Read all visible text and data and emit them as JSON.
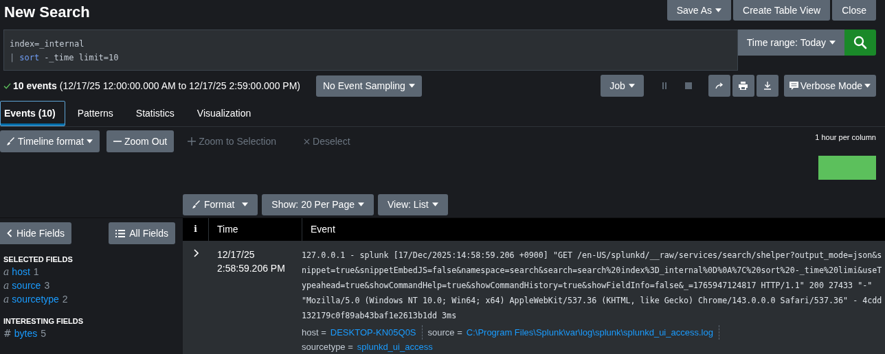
{
  "title": "New Search",
  "header_buttons": [
    {
      "label": "Save As",
      "caret": true
    },
    {
      "label": "Create Table View",
      "caret": false
    },
    {
      "label": "Close",
      "caret": false
    }
  ],
  "search": {
    "lines": [
      [
        {
          "text": "index=_internal",
          "kind": "plain"
        }
      ],
      [
        {
          "text": "|",
          "kind": "pipe"
        },
        {
          "text": "sort",
          "kind": "command"
        },
        {
          "text": "-_time limit=10",
          "kind": "plain"
        }
      ]
    ],
    "time_range": "Time range: Today"
  },
  "status": {
    "summary": "**10 events** (12/17/25 12:00:00.000 AM to 12/17/25 2:59:00.000 PM)",
    "sampling": "No Event Sampling"
  },
  "job": {
    "label": "Job",
    "pause_disabled": true,
    "stop_disabled": true,
    "mode": "Verbose Mode"
  },
  "tabs": [
    {
      "label": "Events (10)",
      "selected": true
    },
    {
      "label": "Patterns",
      "selected": false
    },
    {
      "label": "Statistics",
      "selected": false
    },
    {
      "label": "Visualization",
      "selected": false
    }
  ],
  "timeline": {
    "buttons": [
      {
        "label": "Timeline format",
        "kind": "format",
        "caret": true,
        "disabled": false
      },
      {
        "label": "Zoom Out",
        "kind": "zoomout",
        "caret": false,
        "disabled": false
      },
      {
        "label": "Zoom to Selection",
        "kind": "zoomin",
        "caret": false,
        "disabled": true
      },
      {
        "label": "Deselect",
        "kind": "deselect",
        "caret": false,
        "disabled": true
      }
    ],
    "scale": "1 hour per column"
  },
  "results_toolbar": [
    {
      "label": "Format",
      "kind": "format"
    },
    {
      "label": "Show: 20 Per Page",
      "kind": "menu"
    },
    {
      "label": "View: List",
      "kind": "menu"
    }
  ],
  "sidebar": {
    "hide_button": "Hide Fields",
    "all_button": "All Fields",
    "sections": [
      {
        "title": "SELECTED FIELDS",
        "fields": [
          {
            "type": "a",
            "name": "host",
            "count": "1"
          },
          {
            "type": "a",
            "name": "source",
            "count": "3"
          },
          {
            "type": "a",
            "name": "sourcetype",
            "count": "2"
          }
        ]
      },
      {
        "title": "INTERESTING FIELDS",
        "fields": [
          {
            "type": "#",
            "name": "bytes",
            "count": "5"
          }
        ]
      }
    ]
  },
  "table": {
    "columns": [
      "i",
      "Time",
      "Event"
    ],
    "rows": [
      {
        "expanded": false,
        "time": "12/17/25 2:58:59.206 PM",
        "raw": "127.0.0.1 - splunk [17/Dec/2025:14:58:59.206 +0900] \"GET /en-US/splunkd/__raw/services/search/shelper?output_mode=json&snippet=true&snippetEmbedJS=false&namespace=search&search=search%20index%3D_internal%0D%0A%7C%20sort%20-_time%20limi&useTypeahead=true&showCommandHelp=true&showCommandHistory=true&showFieldInfo=false&_=1765947124817 HTTP/1.1\" 200 27433 \"-\" \"Mozilla/5.0 (Windows NT 10.0; Win64; x64) AppleWebKit/537.36 (KHTML, like Gecko) Chrome/143.0.0.0 Safari/537.36\" - 4cdd132179c0f89ab43baf1e2613b1dd 3ms",
        "fields": [
          {
            "key": "host =",
            "value": "DESKTOP-KN05Q0S"
          },
          {
            "key": "source =",
            "value": "C:\\Program Files\\Splunk\\var\\log\\splunk\\splunkd_ui_access.log"
          },
          {
            "key": "sourcetype =",
            "value": "splunkd_ui_access"
          }
        ]
      }
    ]
  }
}
